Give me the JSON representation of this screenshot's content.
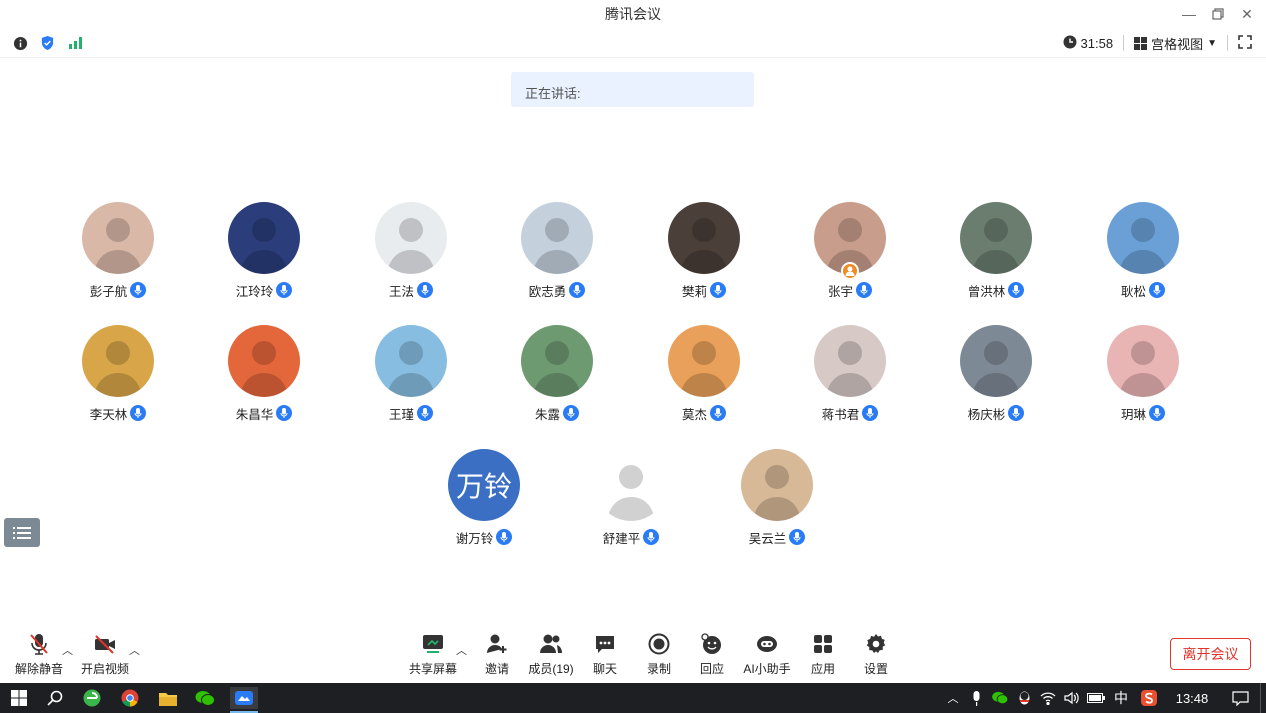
{
  "window": {
    "title": "腾讯会议"
  },
  "topbar": {
    "timer": "31:58",
    "view_label": "宫格视图"
  },
  "speaking_label": "正在讲话:",
  "participants": [
    {
      "name": "彭子航",
      "bg": "#d9b8a8"
    },
    {
      "name": "江玲玲",
      "bg": "#2b3d7a"
    },
    {
      "name": "王法",
      "bg": "#e9ecef"
    },
    {
      "name": "欧志勇",
      "bg": "#c4d1dd"
    },
    {
      "name": "樊莉",
      "bg": "#4a3f39"
    },
    {
      "name": "张宇",
      "bg": "#c99d8c"
    },
    {
      "name": "曾洪林",
      "bg": "#6b7d6e"
    },
    {
      "name": "耿松",
      "bg": "#6aa0d6"
    },
    {
      "name": "李天林",
      "bg": "#d8a648"
    },
    {
      "name": "朱昌华",
      "bg": "#e4663b"
    },
    {
      "name": "王瑾",
      "bg": "#87bde0"
    },
    {
      "name": "朱露",
      "bg": "#6e9a72"
    },
    {
      "name": "莫杰",
      "bg": "#e8a05a"
    },
    {
      "name": "蒋书君",
      "bg": "#d6c9c6"
    },
    {
      "name": "杨庆彬",
      "bg": "#7e8996"
    },
    {
      "name": "玥琳",
      "bg": "#e9b4b4"
    },
    {
      "name": "谢万铃",
      "text": "万铃"
    },
    {
      "name": "舒建平",
      "bg": "#ffffff"
    },
    {
      "name": "吴云兰",
      "bg": "#d7b998"
    }
  ],
  "toolbar": {
    "mute": "解除静音",
    "video": "开启视频",
    "share": "共享屏幕",
    "invite": "邀请",
    "members": "成员(19)",
    "chat": "聊天",
    "record": "录制",
    "reply": "回应",
    "ai": "AI小助手",
    "apps": "应用",
    "settings": "设置",
    "leave": "离开会议"
  },
  "taskbar": {
    "ime": "中",
    "time": "13:48"
  },
  "colors": {
    "accent": "#2a7cf6",
    "danger": "#e0352b",
    "taskbar": "#1e1f22"
  }
}
